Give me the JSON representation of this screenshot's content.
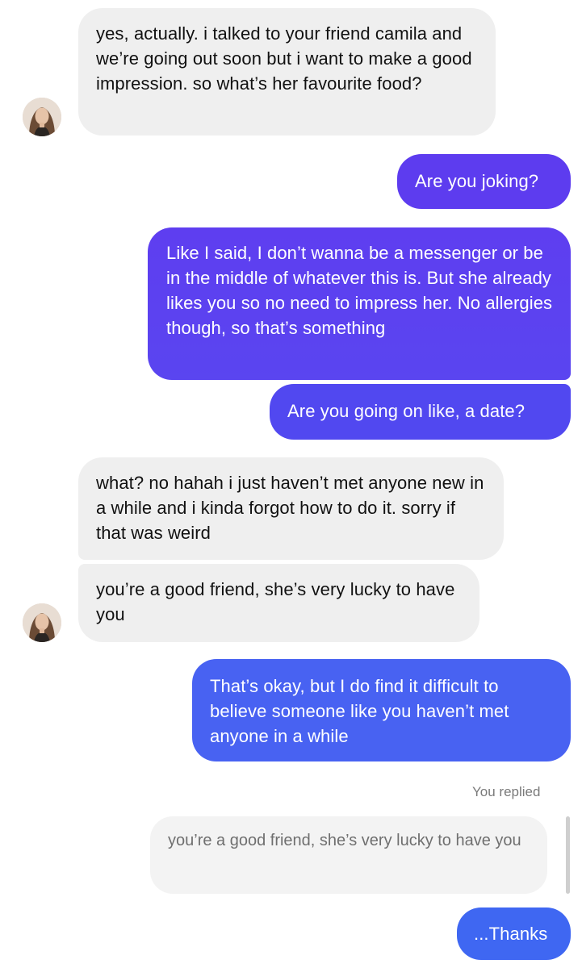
{
  "conversation": {
    "messages": [
      {
        "id": "m1",
        "sender": "contact",
        "text": "yes, actually. i talked to your friend camila and we’re going out soon but i want to make a good impression. so what’s her favourite food?"
      },
      {
        "id": "m2",
        "sender": "me",
        "text": "Are you joking?"
      },
      {
        "id": "m3",
        "sender": "me",
        "text": "Like I said, I don’t wanna be a messenger or be in the middle of whatever this is. But she already likes you so no need to impress her. No allergies though, so that’s something"
      },
      {
        "id": "m4",
        "sender": "me",
        "text": "Are you going on like, a date?"
      },
      {
        "id": "m5",
        "sender": "contact",
        "text": "what? no hahah i just haven’t met anyone new in a while and i kinda forgot how to do it. sorry if that was weird"
      },
      {
        "id": "m6",
        "sender": "contact",
        "text": "you’re a good friend, she’s very lucky to have you"
      },
      {
        "id": "m7",
        "sender": "me",
        "text": "That’s okay, but I do find it difficult to believe someone like you haven’t met anyone in a while"
      },
      {
        "id": "m8",
        "sender": "me",
        "text": "...Thanks"
      }
    ],
    "reply_context": {
      "label": "You replied",
      "quoted_text": "you’re a good friend, she’s very lucky to have you"
    }
  },
  "icons": {
    "avatar": "contact-avatar"
  },
  "colors": {
    "incoming_bg": "#efefef",
    "outgoing_purple": "#5f3ef0",
    "outgoing_blue": "#3f65f2",
    "quote_bg": "#f3f3f3"
  }
}
